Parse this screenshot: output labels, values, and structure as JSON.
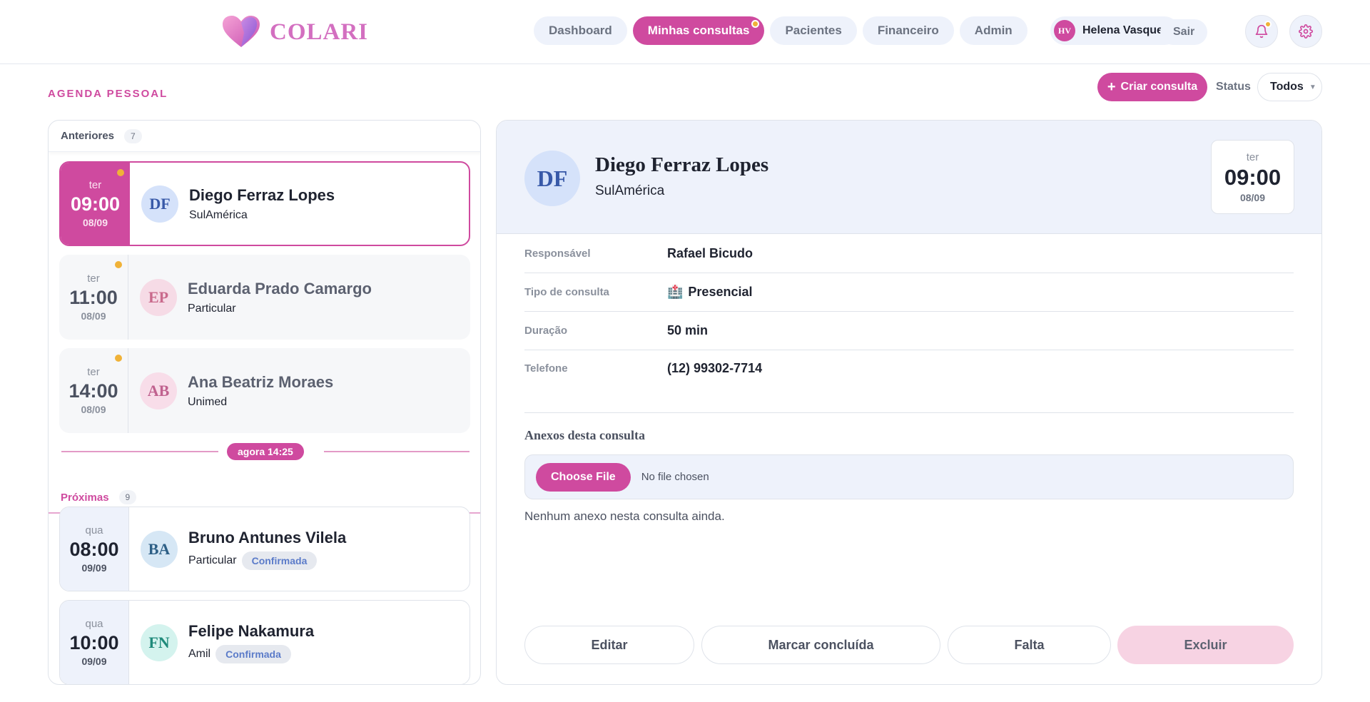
{
  "app": {
    "name": "COLARI"
  },
  "nav": [
    {
      "label": "Dashboard",
      "active": false
    },
    {
      "label": "Minhas consultas",
      "active": true
    },
    {
      "label": "Pacientes",
      "active": false
    },
    {
      "label": "Financeiro",
      "active": false
    },
    {
      "label": "Admin",
      "active": false
    }
  ],
  "user": {
    "initials": "HV",
    "name": "Helena Vasques",
    "logout_label": "Sair"
  },
  "icons": {
    "notifications": "bell-icon",
    "settings": "gear-icon"
  },
  "page": {
    "section_title": "AGENDA PESSOAL",
    "create_label": "Criar consulta",
    "status_label": "Status",
    "status_value": "Todos"
  },
  "list": {
    "past": {
      "label": "Anteriores",
      "count": "7",
      "items": [
        {
          "weekday": "ter",
          "time": "09:00",
          "date": "08/09",
          "initials": "DF",
          "name": "Diego Ferraz Lopes",
          "insurance": "SulAmérica",
          "selected": true
        },
        {
          "weekday": "ter",
          "time": "11:00",
          "date": "08/09",
          "initials": "EP",
          "name": "Eduarda Prado Camargo",
          "insurance": "Particular"
        },
        {
          "weekday": "ter",
          "time": "14:00",
          "date": "08/09",
          "initials": "AB",
          "name": "Ana Beatriz Moraes",
          "insurance": "Unimed"
        }
      ]
    },
    "now_label": "agora 14:25",
    "upcoming": {
      "label": "Próximas",
      "count": "9",
      "items": [
        {
          "weekday": "qua",
          "time": "08:00",
          "date": "09/09",
          "initials": "BA",
          "name": "Bruno Antunes Vilela",
          "insurance": "Particular",
          "status": "Confirmada"
        },
        {
          "weekday": "qua",
          "time": "10:00",
          "date": "09/09",
          "initials": "FN",
          "name": "Felipe Nakamura",
          "insurance": "Amil",
          "status": "Confirmada"
        }
      ]
    }
  },
  "detail": {
    "initials": "DF",
    "name": "Diego Ferraz Lopes",
    "insurance": "SulAmérica",
    "weekday": "ter",
    "time": "09:00",
    "date": "08/09",
    "rows": [
      {
        "label": "Responsável",
        "value": "Rafael Bicudo"
      },
      {
        "label": "Tipo de consulta",
        "value": "Presencial",
        "icon": "🏥"
      },
      {
        "label": "Duração",
        "value": "50 min"
      },
      {
        "label": "Telefone",
        "value": "(12) 99302-7714"
      }
    ],
    "annex_title": "Anexos desta consulta",
    "file_button": "Choose File",
    "file_status": "No file chosen",
    "no_annex": "Nenhum anexo nesta consulta ainda.",
    "actions": {
      "edit": "Editar",
      "complete": "Marcar concluída",
      "absent": "Falta",
      "delete": "Excluir"
    }
  },
  "colors": {
    "accent": "#cf4a9f",
    "soft_blue": "#eef2fb",
    "warning_dot": "#f0b238",
    "danger_soft": "#f7d3e3"
  }
}
